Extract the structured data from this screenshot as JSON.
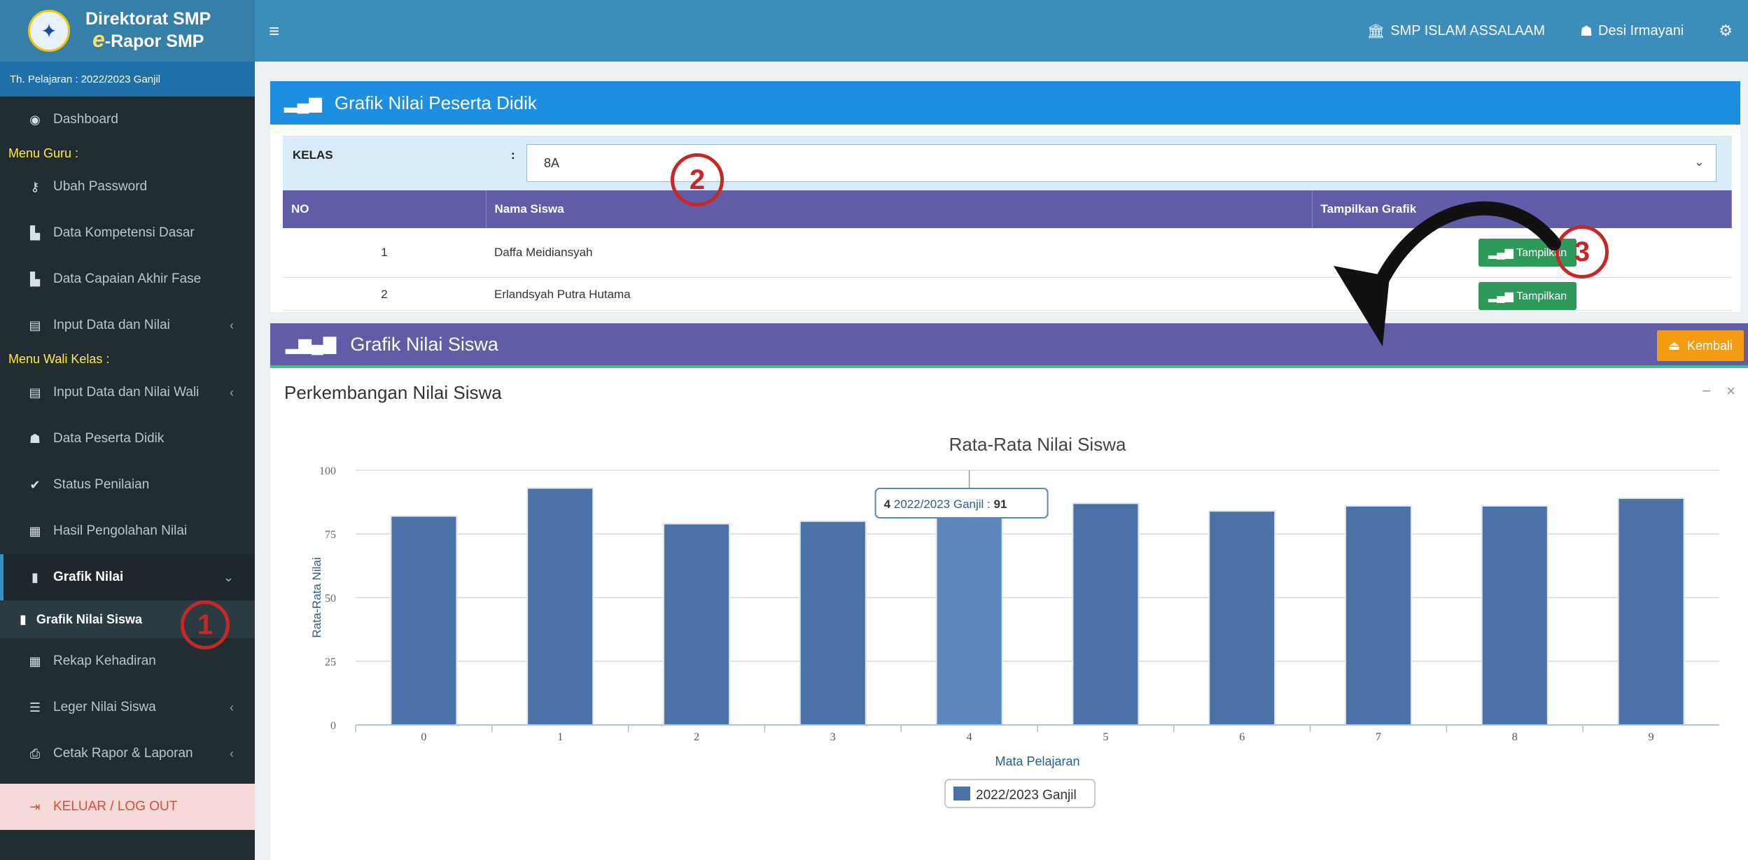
{
  "brand": {
    "line1": "Direktorat SMP",
    "line2_prefix": "e",
    "line2_rest": "-Rapor SMP"
  },
  "sidebar": {
    "year": "Th. Pelajaran : 2022/2023 Ganjil",
    "dashboard": "Dashboard",
    "menu_guru": "Menu Guru :",
    "ubah_password": "Ubah Password",
    "data_kompetensi": "Data Kompetensi Dasar",
    "data_capaian": "Data Capaian Akhir Fase",
    "input_data": "Input Data dan Nilai",
    "menu_wali": "Menu Wali Kelas :",
    "input_wali": "Input Data dan Nilai Wali",
    "data_peserta": "Data Peserta Didik",
    "status_penilaian": "Status Penilaian",
    "hasil_pengolahan": "Hasil Pengolahan Nilai",
    "grafik_nilai": "Grafik Nilai",
    "grafik_nilai_siswa": "Grafik Nilai Siswa",
    "rekap_kehadiran": "Rekap Kehadiran",
    "leger": "Leger Nilai Siswa",
    "cetak": "Cetak Rapor & Laporan",
    "logout": "KELUAR / LOG OUT"
  },
  "topbar": {
    "school": "SMP ISLAM ASSALAAM",
    "user": "Desi Irmayani"
  },
  "peserta": {
    "title": "Grafik Nilai Peserta Didik",
    "kelas_label": "KELAS",
    "kelas_colon": ":",
    "kelas_value": "8A",
    "columns": [
      "NO",
      "Nama Siswa",
      "Tampilkan Grafik"
    ],
    "rows": [
      {
        "no": "1",
        "nama": "Daffa Meidiansyah",
        "button": "Tampilkan"
      },
      {
        "no": "2",
        "nama": "Erlandsyah Putra Hutama",
        "button": "Tampilkan"
      }
    ]
  },
  "grafik": {
    "title": "Grafik Nilai Siswa",
    "kembali": "Kembali",
    "subtitle": "Perkembangan Nilai Siswa"
  },
  "chart_data": {
    "type": "bar",
    "title": "Rata-Rata Nilai Siswa",
    "xlabel": "Mata Pelajaran",
    "ylabel": "Rata-Rata Nilai",
    "categories": [
      "0",
      "1",
      "2",
      "3",
      "4",
      "5",
      "6",
      "7",
      "8",
      "9"
    ],
    "series": [
      {
        "name": "2022/2023 Ganjil",
        "values": [
          82,
          93,
          79,
          80,
          91,
          87,
          84,
          86,
          86,
          89
        ]
      }
    ],
    "ylim": [
      0,
      100
    ],
    "yticks": [
      0,
      25,
      50,
      75,
      100
    ],
    "tooltip": {
      "category": "4",
      "series": "2022/2023 Ganjil",
      "value": 91
    },
    "colors": {
      "bar": "#4a72a6",
      "bar_highlight": "#5b87bd"
    }
  },
  "annotations": [
    "1",
    "2",
    "3"
  ]
}
